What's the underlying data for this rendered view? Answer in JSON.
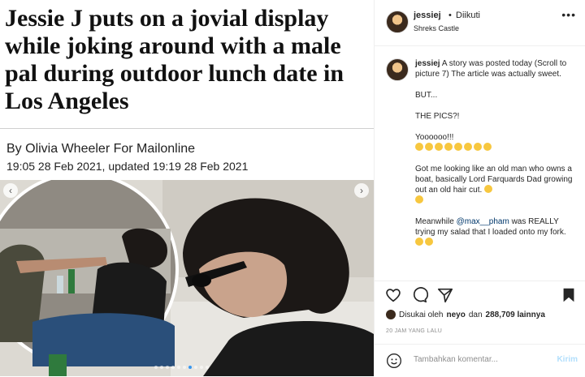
{
  "article": {
    "headline": "Jessie J puts on a jovial display while joking around with a male pal during outdoor lunch date in Los Angeles",
    "byline": "By Olivia Wheeler For Mailonline",
    "date": "19:05 28 Feb 2021, updated 19:19 28 Feb 2021"
  },
  "carousel": {
    "prev_icon": "‹",
    "next_icon": "›",
    "slide_count": 10,
    "active_index": 6
  },
  "post": {
    "username": "jessiej",
    "separator": "•",
    "follow_status": "Diikuti",
    "location": "Shreks Castle",
    "more_icon": "•••",
    "caption": {
      "username": "jessiej",
      "lines": [
        "A story was posted today (Scroll to picture 7) The article was actually sweet.",
        "BUT...",
        "THE PICS?!",
        "Yoooooo!!!",
        "Got me looking like an old man who owns a boat, basically Lord Farquards Dad growing out an old hair cut.",
        "Meanwhile",
        "was REALLY trying my salad that I loaded onto my fork."
      ],
      "mention": "@max__pham"
    },
    "likes_prefix": "Disukai oleh",
    "likes_user": "neyo",
    "likes_and": "dan",
    "likes_count": "288,709 lainnya",
    "time_ago": "20 JAM YANG LALU",
    "comment_placeholder": "Tambahkan komentar...",
    "post_button": "Kirim"
  },
  "colors": {
    "link": "#00376b",
    "post_disabled": "#b2dffc",
    "emoji": "#f7c73f"
  }
}
